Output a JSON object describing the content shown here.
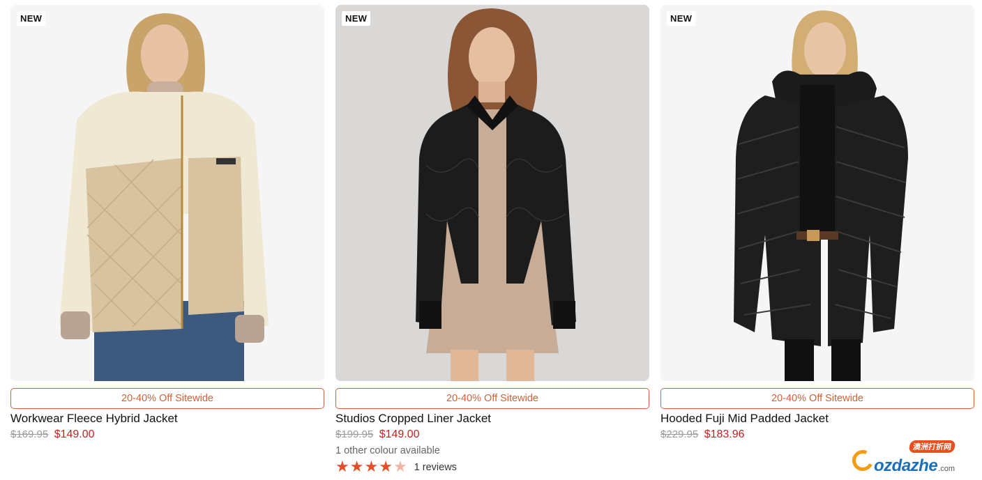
{
  "products": [
    {
      "badge": "NEW",
      "promo": "20-40% Off Sitewide",
      "title": "Workwear Fleece Hybrid Jacket",
      "old_price": "$169.95",
      "price": "$149.00"
    },
    {
      "badge": "NEW",
      "promo": "20-40% Off Sitewide",
      "title": "Studios Cropped Liner Jacket",
      "old_price": "$199.95",
      "price": "$149.00",
      "colours": "1 other colour available",
      "rating": 4,
      "rating_max": 5,
      "reviews": "1 reviews"
    },
    {
      "badge": "NEW",
      "promo": "20-40% Off Sitewide",
      "title": "Hooded Fuji Mid Padded Jacket",
      "old_price": "$229.95",
      "price": "$183.96"
    }
  ],
  "watermark": {
    "tag": "澳洲打折网",
    "name": "ozdazhe",
    "domain": ".com"
  },
  "colors": {
    "promo": "#c8643c",
    "sale_price": "#c81e1e",
    "star": "#e2502b"
  }
}
